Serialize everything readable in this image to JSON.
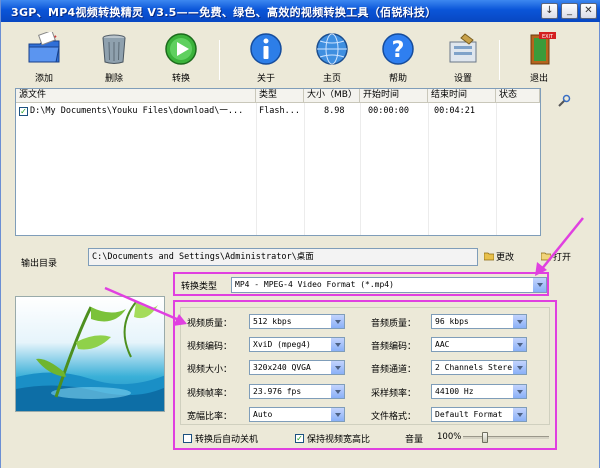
{
  "window": {
    "title": "3GP、MP4视频转换精灵 V3.5——免费、绿色、高效的视频转换工具（佰锐科技）",
    "min_glyph": "_",
    "close_glyph": "✕"
  },
  "toolbar": {
    "add": "添加",
    "delete": "删除",
    "convert": "转换",
    "about": "关于",
    "home": "主页",
    "help": "帮助",
    "settings": "设置",
    "exit": "退出"
  },
  "file_list": {
    "columns": [
      "源文件",
      "类型",
      "大小（MB）",
      "开始时间",
      "结束时间",
      "状态"
    ],
    "rows": [
      {
        "checked": true,
        "source": "D:\\My Documents\\Youku Files\\download\\一...",
        "type": "Flash...",
        "size": "8.98",
        "start": "00:00:00",
        "end": "00:04:21",
        "status": ""
      }
    ]
  },
  "output": {
    "label": "输出目录",
    "path": "C:\\Documents and Settings\\Administrator\\桌面",
    "change": "更改",
    "open": "打开"
  },
  "convert_type": {
    "label": "转换类型",
    "value": "MP4 - MPEG-4 Video Format (*.mp4)"
  },
  "params": {
    "video_quality_label": "视频质量：",
    "video_quality": "512 kbps",
    "video_codec_label": "视频编码：",
    "video_codec": "XviD (mpeg4)",
    "video_size_label": "视频大小：",
    "video_size": "320x240 QVGA",
    "video_fps_label": "视频帧率：",
    "video_fps": "23.976 fps",
    "aspect_label": "宽幅比率：",
    "aspect": "Auto",
    "audio_quality_label": "音频质量：",
    "audio_quality": "96  kbps",
    "audio_codec_label": "音频编码：",
    "audio_codec": "AAC",
    "audio_channel_label": "音频通道：",
    "audio_channel": "2 Channels Stereo",
    "sample_rate_label": "采样频率：",
    "sample_rate": "44100 Hz",
    "file_format_label": "文件格式：",
    "file_format": "Default Format"
  },
  "bottom": {
    "auto_shutdown": "转换后自动关机",
    "auto_shutdown_checked": false,
    "keep_ratio": "保持视频宽高比",
    "keep_ratio_checked": true,
    "volume_label": "音量",
    "volume_value": "100%",
    "volume_fraction": 0.25
  },
  "colors": {
    "highlight": "#e040e0",
    "titlebar": "#0a55d8"
  }
}
